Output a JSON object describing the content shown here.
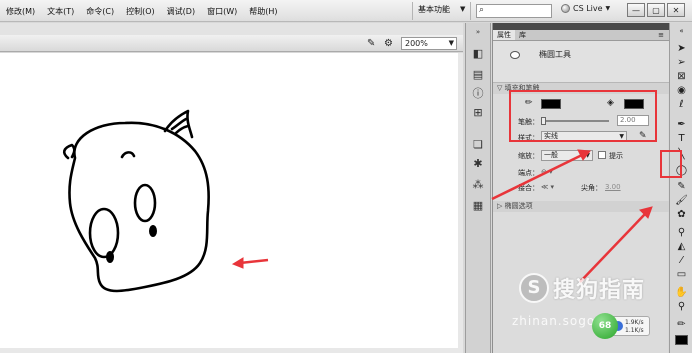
{
  "menubar": {
    "items": [
      "修改(M)",
      "文本(T)",
      "命令(C)",
      "控制(O)",
      "调试(D)",
      "窗口(W)",
      "帮助(H)"
    ],
    "workspace_label": "基本功能",
    "search_placeholder": "",
    "cs_live": "CS Live",
    "window_buttons": [
      "—",
      "▢",
      "✕"
    ]
  },
  "stage": {
    "zoom": "200%"
  },
  "panel": {
    "tabs": [
      "属性",
      "库"
    ],
    "tool_name": "椭圆工具",
    "fill_stroke_section": "填充和笔触",
    "stroke_label": "笔触：",
    "stroke_value": "2.00",
    "style_label": "样式：",
    "style_value": "实线",
    "scale_label": "缩放：",
    "scale_value": "一般",
    "hint_label": "提示",
    "cap_label": "端点：",
    "join_label": "接合：",
    "miter_label": "尖角：",
    "miter_value": "3.00",
    "oval_section": "椭圆选项"
  },
  "watermark": {
    "logo": "S",
    "text": "搜狗指南",
    "url": "zhinan.sogou.com"
  },
  "net_widget": {
    "badge": "68",
    "upload": "1.9K/s",
    "download": "1.1K/s"
  },
  "colors": {
    "annotation_red": "#e8353a",
    "stroke_color": "#000000",
    "fill_color": "#000000"
  }
}
